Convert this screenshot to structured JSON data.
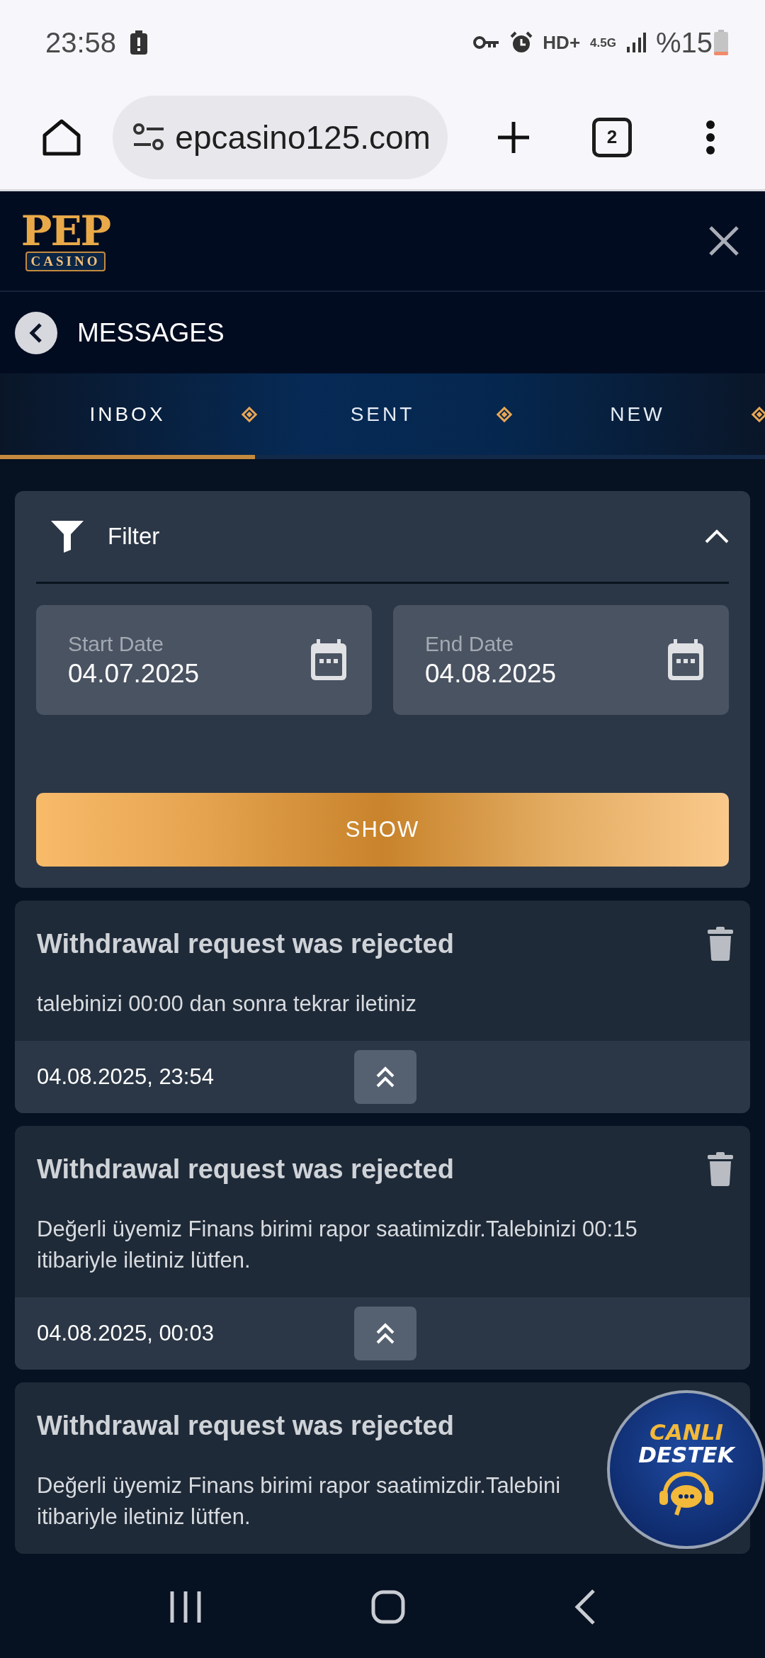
{
  "status_bar": {
    "time": "23:58",
    "hd_label": "HD+",
    "network_label": "4.5G",
    "battery_text": "%15"
  },
  "browser": {
    "url": "epcasino125.com",
    "tab_count": "2"
  },
  "logo": {
    "line1": "PEP",
    "line2": "CASINO"
  },
  "page_title": "MESSAGES",
  "tabs": [
    {
      "label": "INBOX",
      "selected": true
    },
    {
      "label": "SENT",
      "selected": false
    },
    {
      "label": "NEW",
      "selected": false
    }
  ],
  "filter": {
    "title": "Filter",
    "expanded": true,
    "fields": [
      {
        "label": "Start Date",
        "value": "04.07.2025"
      },
      {
        "label": "End Date",
        "value": "04.08.2025"
      }
    ],
    "button": "SHOW"
  },
  "messages": [
    {
      "title": "Withdrawal request was rejected",
      "body_lines": [
        "talebinizi 00:00 dan sonra tekrar iletiniz"
      ],
      "date": "04.08.2025, 23:54"
    },
    {
      "title": "Withdrawal request was rejected",
      "body_lines": [
        "Değerli üyemiz Finans birimi rapor saatimizdir.Talebinizi 00:15",
        "itibariyle iletiniz lütfen."
      ],
      "date": "04.08.2025, 00:03"
    },
    {
      "title": "Withdrawal request was rejected",
      "body_lines": [
        "Değerli üyemiz Finans birimi rapor saatimizdir.Talebini",
        "itibariyle iletiniz lütfen."
      ]
    }
  ],
  "support_button": {
    "line1": "CANLI",
    "line2": "DESTEK"
  }
}
